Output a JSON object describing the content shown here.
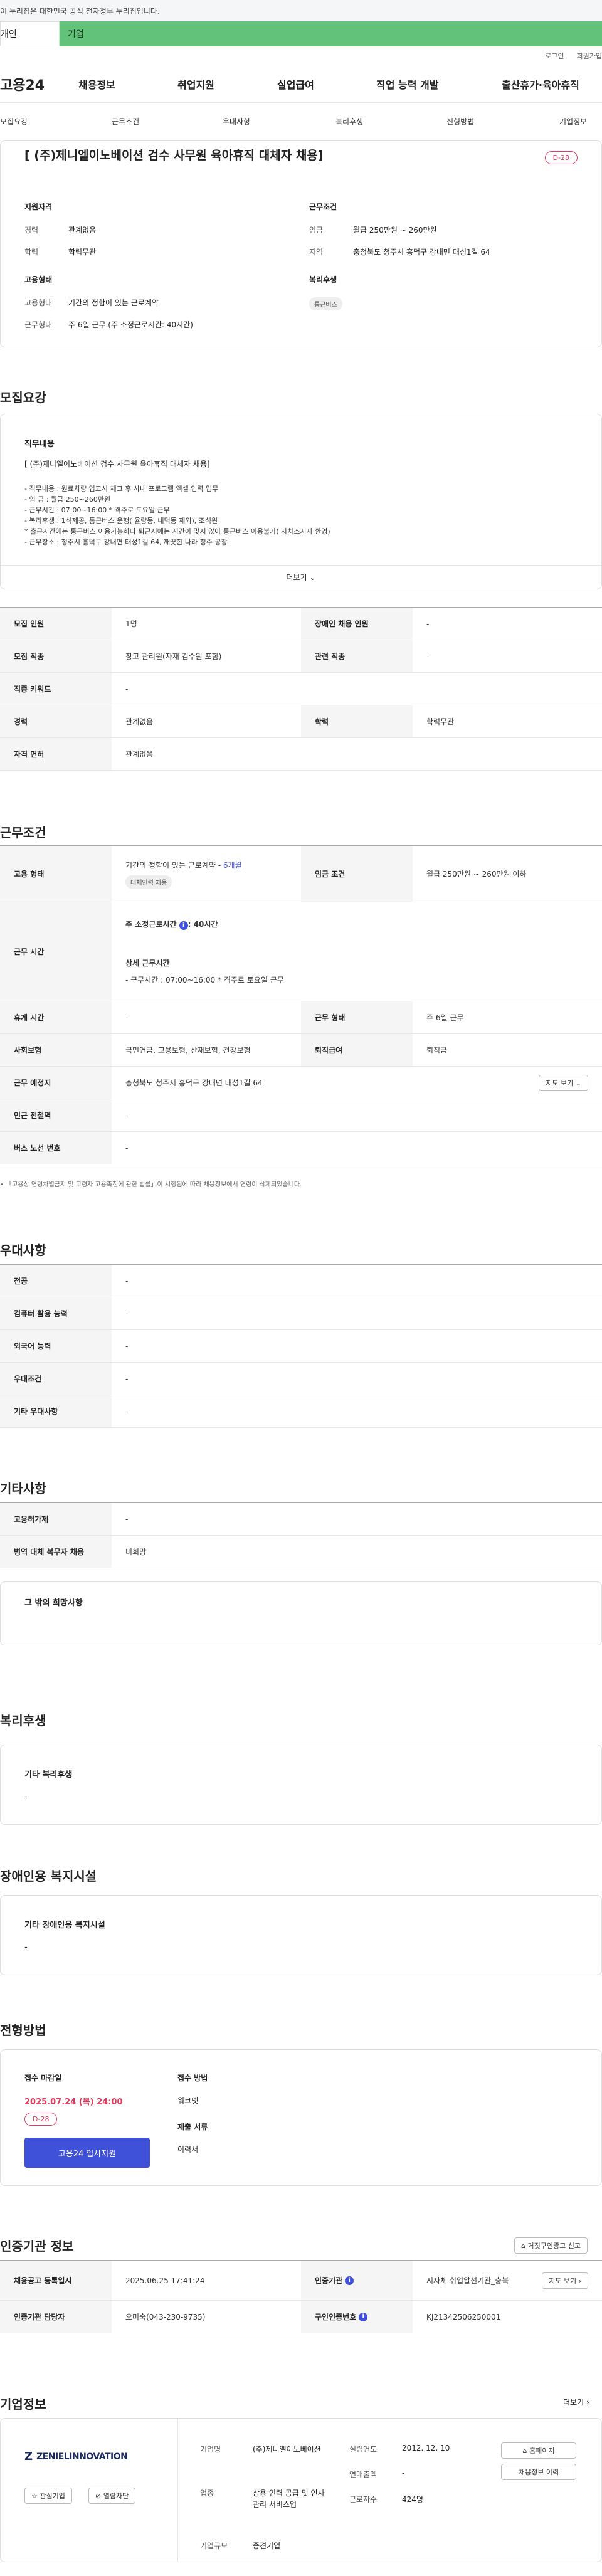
{
  "gov_banner": "이 누리집은 대한민국 공식 전자정부 누리집입니다.",
  "toggle": {
    "personal": "개인",
    "company": "기업"
  },
  "util": {
    "login": "로그인",
    "join": "회원가입"
  },
  "gnb": {
    "logo": "고용24",
    "menus": [
      "채용정보",
      "취업지원",
      "실업급여",
      "직업 능력 개발",
      "출산휴가·육아휴직"
    ]
  },
  "tabs": [
    "모집요강",
    "근무조건",
    "우대사항",
    "복리후생",
    "전형방법",
    "기업정보"
  ],
  "summary": {
    "title": "[ (주)제니엘이노베이션 검수 사무원 육아휴직 대체자 채용]",
    "dday": "D-28",
    "qualification": {
      "heading": "지원자격",
      "rows": [
        {
          "k": "경력",
          "v": "관계없음"
        },
        {
          "k": "학력",
          "v": "학력무관"
        }
      ]
    },
    "work": {
      "heading": "근무조건",
      "rows": [
        {
          "k": "임금",
          "v": "월급 250만원 ~ 260만원"
        },
        {
          "k": "지역",
          "v": "충청북도 청주시 흥덕구 강내면 태성1길 64"
        }
      ]
    },
    "emp": {
      "heading": "고용형태",
      "rows": [
        {
          "k": "고용형태",
          "v": "기간의 정함이 있는 근로계약"
        },
        {
          "k": "근무형태",
          "v": "주 6일 근무 (주 소정근로시간: 40시간)"
        }
      ]
    },
    "welfare": {
      "heading": "복리후생",
      "chip": "통근버스"
    }
  },
  "recruit": {
    "title": "모집요강",
    "job_heading": "직무내용",
    "job_title": "[ (주)제니엘이노베이션 검수 사무원 육아휴직 대체자  채용]",
    "lines": [
      "- 직무내용 :  원료차량 입고시 체크 후 사내 프로그램 엑셀 입력 업무",
      "- 임        금 : 월급 250~260만원",
      "- 근무시간 : 07:00~16:00    * 격주로 토요일 근무",
      "- 복리후생 : 1식제공, 통근버스 운행( 율량동, 내덕동 제외), 조식왼",
      "* 출근시간에는 통근버스 이용가능하나 퇴근시에는 시간이 맞지 않아 통근버스 이용불가( 자차소지자 환영)",
      "- 근무장소 : 청주시 흥덕구 강내면 태성1길 64, 깨끗한 나라 청주 공장"
    ],
    "more": "더보기",
    "table": [
      {
        "k1": "모집 인원",
        "v1": "1명",
        "k2": "장애인 채용 인원",
        "v2": "-"
      },
      {
        "k1": "모집 직종",
        "v1": "창고 관리원(자재 검수원 포함)",
        "k2": "관련 직종",
        "v2": "-"
      },
      {
        "k1": "직종 키워드",
        "v1": "-"
      },
      {
        "k1": "경력",
        "v1": "관계없음",
        "k2": "학력",
        "v2": "학력무관"
      },
      {
        "k1": "자격 면허",
        "v1": "관계없음"
      }
    ]
  },
  "work": {
    "title": "근무조건",
    "emp_type_label": "고용 형태",
    "emp_type_value": "기간의 정함이 있는 근로계약 - ",
    "emp_period": "6개월",
    "emp_chip": "대체인력 채용",
    "wage_label": "임금 조건",
    "wage_value": "월급 250만원 ~ 260만원 이하",
    "hours_label": "근무 시간",
    "hours_weekly": "주 소정근로시간 ",
    "hours_weekly_val": ": 40시간",
    "hours_detail_heading": "상세 근무시간",
    "hours_detail": "- 근무시간 : 07:00~16:00    * 격주로 토요일 근무",
    "rest_label": "휴게 시간",
    "rest_value": "-",
    "form_label": "근무 형태",
    "form_value": "주 6일 근무",
    "ins_label": "사회보험",
    "ins_value": "국민연금, 고용보험, 산재보험, 건강보험",
    "sev_label": "퇴직급여",
    "sev_value": "퇴직금",
    "place_label": "근무 예정지",
    "place_value": "충청북도 청주시 흥덕구 강내면 태성1길 64",
    "map_btn": "지도 보기",
    "station_label": "인근 전철역",
    "station_value": "-",
    "bus_label": "버스 노선 번호",
    "bus_value": "-",
    "notice": "「고용상 연령차별금지 및 고령자 고용촉진에 관한 법률」이 시행됨에 따라 채용정보에서 연령이 삭제되었습니다."
  },
  "pref": {
    "title": "우대사항",
    "rows": [
      {
        "k": "전공",
        "v": "-"
      },
      {
        "k": "컴퓨터 활용 능력",
        "v": "-"
      },
      {
        "k": "외국어 능력",
        "v": "-"
      },
      {
        "k": "우대조건",
        "v": "-"
      },
      {
        "k": "기타 우대사항",
        "v": "-"
      }
    ]
  },
  "etc": {
    "title": "기타사항",
    "rows": [
      {
        "k": "고용허가제",
        "v": "-"
      },
      {
        "k": "병역 대체 복무자 채용",
        "v": "비희망"
      }
    ],
    "hope_heading": "그 밖의 희망사항"
  },
  "welfare": {
    "title": "복리후생",
    "heading": "기타 복리후생",
    "value": "-"
  },
  "disabled": {
    "title": "장애인용 복지시설",
    "heading": "기타 장애인용 복지시설",
    "value": "-"
  },
  "screening": {
    "title": "전형방법",
    "deadline_heading": "접수 마감일",
    "deadline": "2025.07.24 (목) 24:00",
    "dday": "D-28",
    "apply_btn": "고용24 입사지원",
    "method_heading": "접수 방법",
    "method": "워크넷",
    "docs_heading": "제출 서류",
    "docs": "이력서"
  },
  "cert": {
    "title": "인증기관 정보",
    "report_btn": "거짓구인광고 신고",
    "date_label": "채용공고 등록일시",
    "date": "2025.06.25 17:41:24",
    "org_label": "인증기관",
    "org": "지자체 취업알선기관_충북",
    "map_btn": "지도 보기",
    "manager_label": "인증기관 담당자",
    "manager": "오미숙(043-230-9735)",
    "no_label": "구인인증번호",
    "no": "KJ21342506250001"
  },
  "company": {
    "title": "기업정보",
    "more": "더보기",
    "logo": "ZENIELINNOVATION",
    "fav_btn": "관심기업",
    "block_btn": "열람차단",
    "name_label": "기업명",
    "name": "(주)제니엘이노베이션",
    "year_label": "설립연도",
    "year": "2012. 12. 10",
    "sales_label": "연매출액",
    "sales": "-",
    "biz_label": "업종",
    "biz": "상용 인력 공급 및 인사관리 서비스업",
    "emp_label": "근로자수",
    "emp": "424명",
    "size_label": "기업규모",
    "size": "중견기업",
    "home_btn": "홈페이지",
    "list_btn": "채용정보 이력"
  },
  "colors": {
    "accent": "#3f51d8",
    "dday": "#e03a5c",
    "company_toggle": "#63c27a"
  }
}
